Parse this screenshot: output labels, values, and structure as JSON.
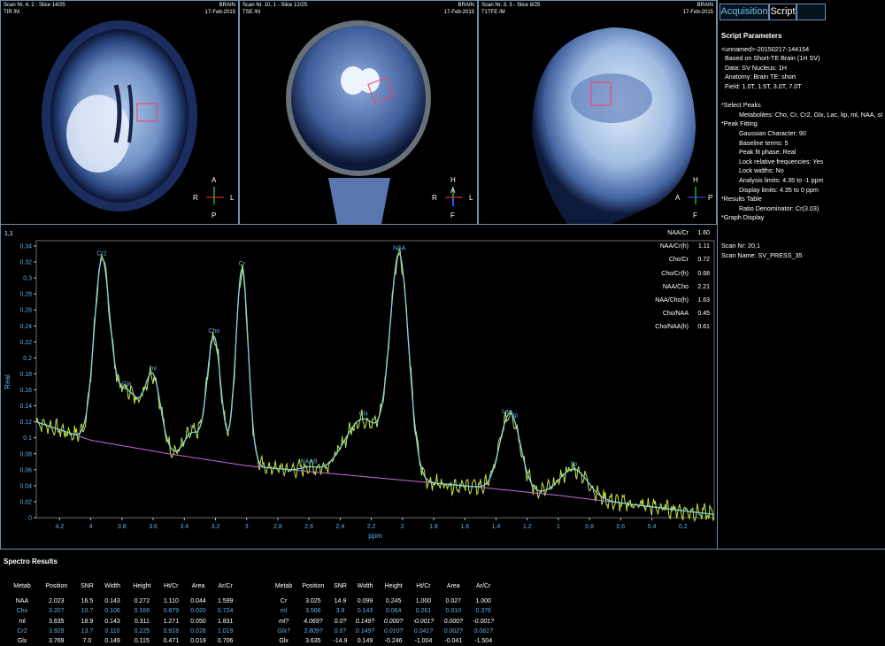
{
  "viewports": [
    {
      "scan": "Scan Nr. 4, 2 - Slice 14/25",
      "seq": "TIR /M",
      "anatomy": "BRAIN",
      "date": "17-Feb-2015",
      "orient": {
        "top": "A",
        "left": "R",
        "right": "L",
        "bottom": "P"
      }
    },
    {
      "scan": "Scan Nr. 10, 1 - Slice 12/25",
      "seq": "TSE /M",
      "anatomy": "BRAIN",
      "date": "17-Feb-2015",
      "orient": {
        "top": "H",
        "left": "R",
        "right": "L",
        "bottom": "F",
        "center": "A"
      }
    },
    {
      "scan": "Scan Nr. 3, 3 - Slice 8/25",
      "seq": "T1TFE /M",
      "anatomy": "BRAIN",
      "date": "17-Feb-2015",
      "orient": {
        "top": "H",
        "left": "A",
        "right": "P",
        "bottom": "F"
      }
    }
  ],
  "tabs": [
    "Acquisition",
    "Script",
    ""
  ],
  "script_params": {
    "title": "Script Parameters",
    "lines": [
      "<unnamed>-20150217-144154",
      " Based on Short-TE Brain (1H SV)",
      " Data: SV   Nucleus: 1H",
      " Anatomy: Brain   TE: short",
      " Field: 1.0T, 1.5T, 3.0T, 7.0T",
      "",
      "*Select Peaks",
      "     Metabolites: Cho, Cr, Cr2, Glx, Lac, lip, ml, NAA, sI",
      "*Peak Fitting",
      "     Gaussian Character: 90",
      "     Baseline terms: 5",
      "     Peak fit phase: Real",
      "     Lock relative frequencies: Yes",
      "     Lock widths: No",
      "     Analysis limits: 4.35 to -1 ppm",
      "     Display limits: 4.35 to 0 ppm",
      "*Results Table",
      "     Ratio Denominator: Cr(3.03)",
      "*Graph Display",
      "",
      "",
      "Scan Nr: 20,1",
      "Scan Name: SV_PRESS_35"
    ]
  },
  "spectrum": {
    "index": "1,1",
    "ratios": [
      {
        "label": "NAA/Cr",
        "value": "1.60"
      },
      {
        "label": "NAA/Cr(h)",
        "value": "1.11"
      },
      {
        "label": "Cho/Cr",
        "value": "0.72"
      },
      {
        "label": "Cho/Cr(h)",
        "value": "0.68"
      },
      {
        "label": "NAA/Cho",
        "value": "2.21"
      },
      {
        "label": "NAA/Cho(h)",
        "value": "1.63"
      },
      {
        "label": "Cho/NAA",
        "value": "0.45"
      },
      {
        "label": "Cho/NAA(h)",
        "value": "0.61"
      }
    ]
  },
  "chart_data": {
    "type": "line",
    "xlabel": "ppm",
    "ylabel": "Real",
    "xlim": [
      4.35,
      0
    ],
    "ylim": [
      0,
      0.34
    ],
    "x_ticks": [
      "4.2",
      "4",
      "3.8",
      "3.6",
      "3.4",
      "3.2",
      "3",
      "2.8",
      "2.6",
      "2.4",
      "2.2",
      "2",
      "1.8",
      "1.6",
      "1.4",
      "1.2",
      "1",
      "0.8",
      "0.6",
      "0.4",
      "0.2"
    ],
    "y_ticks": [
      "0",
      "0.02",
      "0.04",
      "0.06",
      "0.08",
      "0.1",
      "0.12",
      "0.14",
      "0.16",
      "0.18",
      "0.2",
      "0.22",
      "0.24",
      "0.26",
      "0.28",
      "0.3",
      "0.32",
      "0.34"
    ],
    "baseline": {
      "x": [
        4.35,
        4.0,
        3.5,
        3.0,
        2.5,
        2.0,
        1.5,
        1.0,
        0.5,
        0.0
      ],
      "y": [
        0.12,
        0.097,
        0.08,
        0.065,
        0.056,
        0.047,
        0.038,
        0.028,
        0.016,
        0.004
      ]
    },
    "peaks": [
      {
        "name": "Cr2",
        "ppm": 3.93,
        "height": 0.215,
        "width": 0.05
      },
      {
        "name": "Glx",
        "ppm": 3.77,
        "height": 0.07,
        "width": 0.09
      },
      {
        "name": "ml",
        "ppm": 3.6,
        "height": 0.085,
        "width": 0.05
      },
      {
        "name": "sI",
        "ppm": 3.35,
        "height": 0.03,
        "width": 0.05
      },
      {
        "name": "Cho",
        "ppm": 3.21,
        "height": 0.155,
        "width": 0.045
      },
      {
        "name": "Cr",
        "ppm": 3.03,
        "height": 0.245,
        "width": 0.04
      },
      {
        "name": "NAAB",
        "ppm": 2.6,
        "height": 0.005,
        "width": 0.05
      },
      {
        "name": "Glx",
        "ppm": 2.25,
        "height": 0.072,
        "width": 0.12
      },
      {
        "name": "NAA",
        "ppm": 2.02,
        "height": 0.272,
        "width": 0.06
      },
      {
        "name": "Lac",
        "ppm": 1.33,
        "height": 0.06,
        "width": 0.06
      },
      {
        "name": "lip",
        "ppm": 1.28,
        "height": 0.045,
        "width": 0.06
      },
      {
        "name": "lip",
        "ppm": 0.9,
        "height": 0.035,
        "width": 0.09
      }
    ],
    "series": [
      {
        "name": "fit",
        "color": "#7fd4e8"
      },
      {
        "name": "baseline",
        "color": "#c76ee0"
      },
      {
        "name": "data",
        "color": "#c8e63a"
      }
    ]
  },
  "results": {
    "title": "Spectro Results",
    "headers": [
      "Metab",
      "Position",
      "SNR",
      "Width",
      "Height",
      "Ht/Cr",
      "Area",
      "Ar/Cr"
    ],
    "left_rows": [
      {
        "style": "c-w",
        "cells": [
          "NAA",
          "2.023",
          "16.5",
          "0.143",
          "0.272",
          "1.110",
          "0.044",
          "1.599"
        ]
      },
      {
        "style": "c-b",
        "cells": [
          "Cho",
          "3.207",
          "10.7",
          "0.106",
          "0.166",
          "0.679",
          "0.020",
          "0.724"
        ]
      },
      {
        "style": "c-w",
        "cells": [
          "ml",
          "3.635",
          "18.9",
          "0.143",
          "0.311",
          "1.271",
          "0.050",
          "1.831"
        ]
      },
      {
        "style": "c-b",
        "cells": [
          "Cr2",
          "3.929",
          "13.7",
          "0.110",
          "0.225",
          "0.918",
          "0.028",
          "1.019"
        ]
      },
      {
        "style": "c-w",
        "cells": [
          "Glx",
          "3.769",
          "7.0",
          "0.149",
          "0.115",
          "0.471",
          "0.019",
          "0.706"
        ]
      }
    ],
    "right_rows": [
      {
        "style": "c-w",
        "cells": [
          "Cr",
          "3.025",
          "14.9",
          "0.099",
          "0.245",
          "1.000",
          "0.027",
          "1.000"
        ]
      },
      {
        "style": "c-b",
        "cells": [
          "ml",
          "3.566",
          "3.9",
          "0.143",
          "0.064",
          "0.261",
          "0.010",
          "0.376"
        ]
      },
      {
        "style": "c-i",
        "cells": [
          "ml?",
          "4.069?",
          "0.0?",
          "0.149?",
          "0.000?",
          "-0.001?",
          "0.000?",
          "-0.001?"
        ]
      },
      {
        "style": "c-ib",
        "cells": [
          "Glx?",
          "3.809?",
          "0.6?",
          "0.149?",
          "0.010?",
          "0.041?",
          "0.002?",
          "0.061?"
        ]
      },
      {
        "style": "c-w",
        "cells": [
          "Glx",
          "3.635",
          "-14.9",
          "0.149",
          "-0.246",
          "-1.004",
          "-0.041",
          "-1.504"
        ]
      }
    ]
  }
}
